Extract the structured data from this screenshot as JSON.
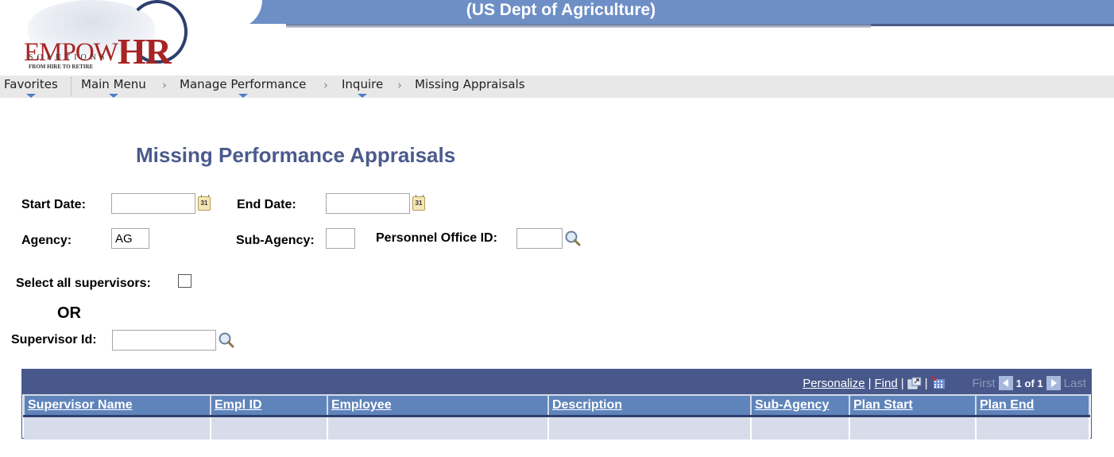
{
  "header": {
    "banner_title": "(US Dept of Agriculture)",
    "logo": {
      "brand_part1": "EMPOW",
      "brand_part2": "HR",
      "sub": "SOLUTIONS",
      "tagline": "FROM HIRE TO RETIRE"
    }
  },
  "nav": {
    "favorites": "Favorites",
    "items": [
      "Main Menu",
      "Manage Performance",
      "Inquire",
      "Missing Appraisals"
    ],
    "separator": "›"
  },
  "page": {
    "title": "Missing Performance Appraisals"
  },
  "form": {
    "start_date": {
      "label": "Start Date:",
      "value": ""
    },
    "end_date": {
      "label": "End Date:",
      "value": ""
    },
    "agency": {
      "label": "Agency:",
      "value": "AG"
    },
    "sub_agency": {
      "label": "Sub-Agency:",
      "value": ""
    },
    "personnel_office": {
      "label": "Personnel Office ID:",
      "value": ""
    },
    "select_all": {
      "label": "Select all supervisors:",
      "checked": false
    },
    "or_text": "OR",
    "supervisor_id": {
      "label": "Supervisor Id:",
      "value": ""
    },
    "calendar_icon_text": "31"
  },
  "grid": {
    "personalize": "Personalize",
    "find": "Find",
    "pipe": "|",
    "first": "First",
    "page_count": "1 of 1",
    "last": "Last",
    "columns": [
      "Supervisor Name",
      "Empl ID",
      "Employee",
      "Description",
      "Sub-Agency",
      "Plan Start",
      "Plan End"
    ],
    "rows": [
      [
        "",
        "",
        "",
        "",
        "",
        "",
        ""
      ]
    ]
  }
}
